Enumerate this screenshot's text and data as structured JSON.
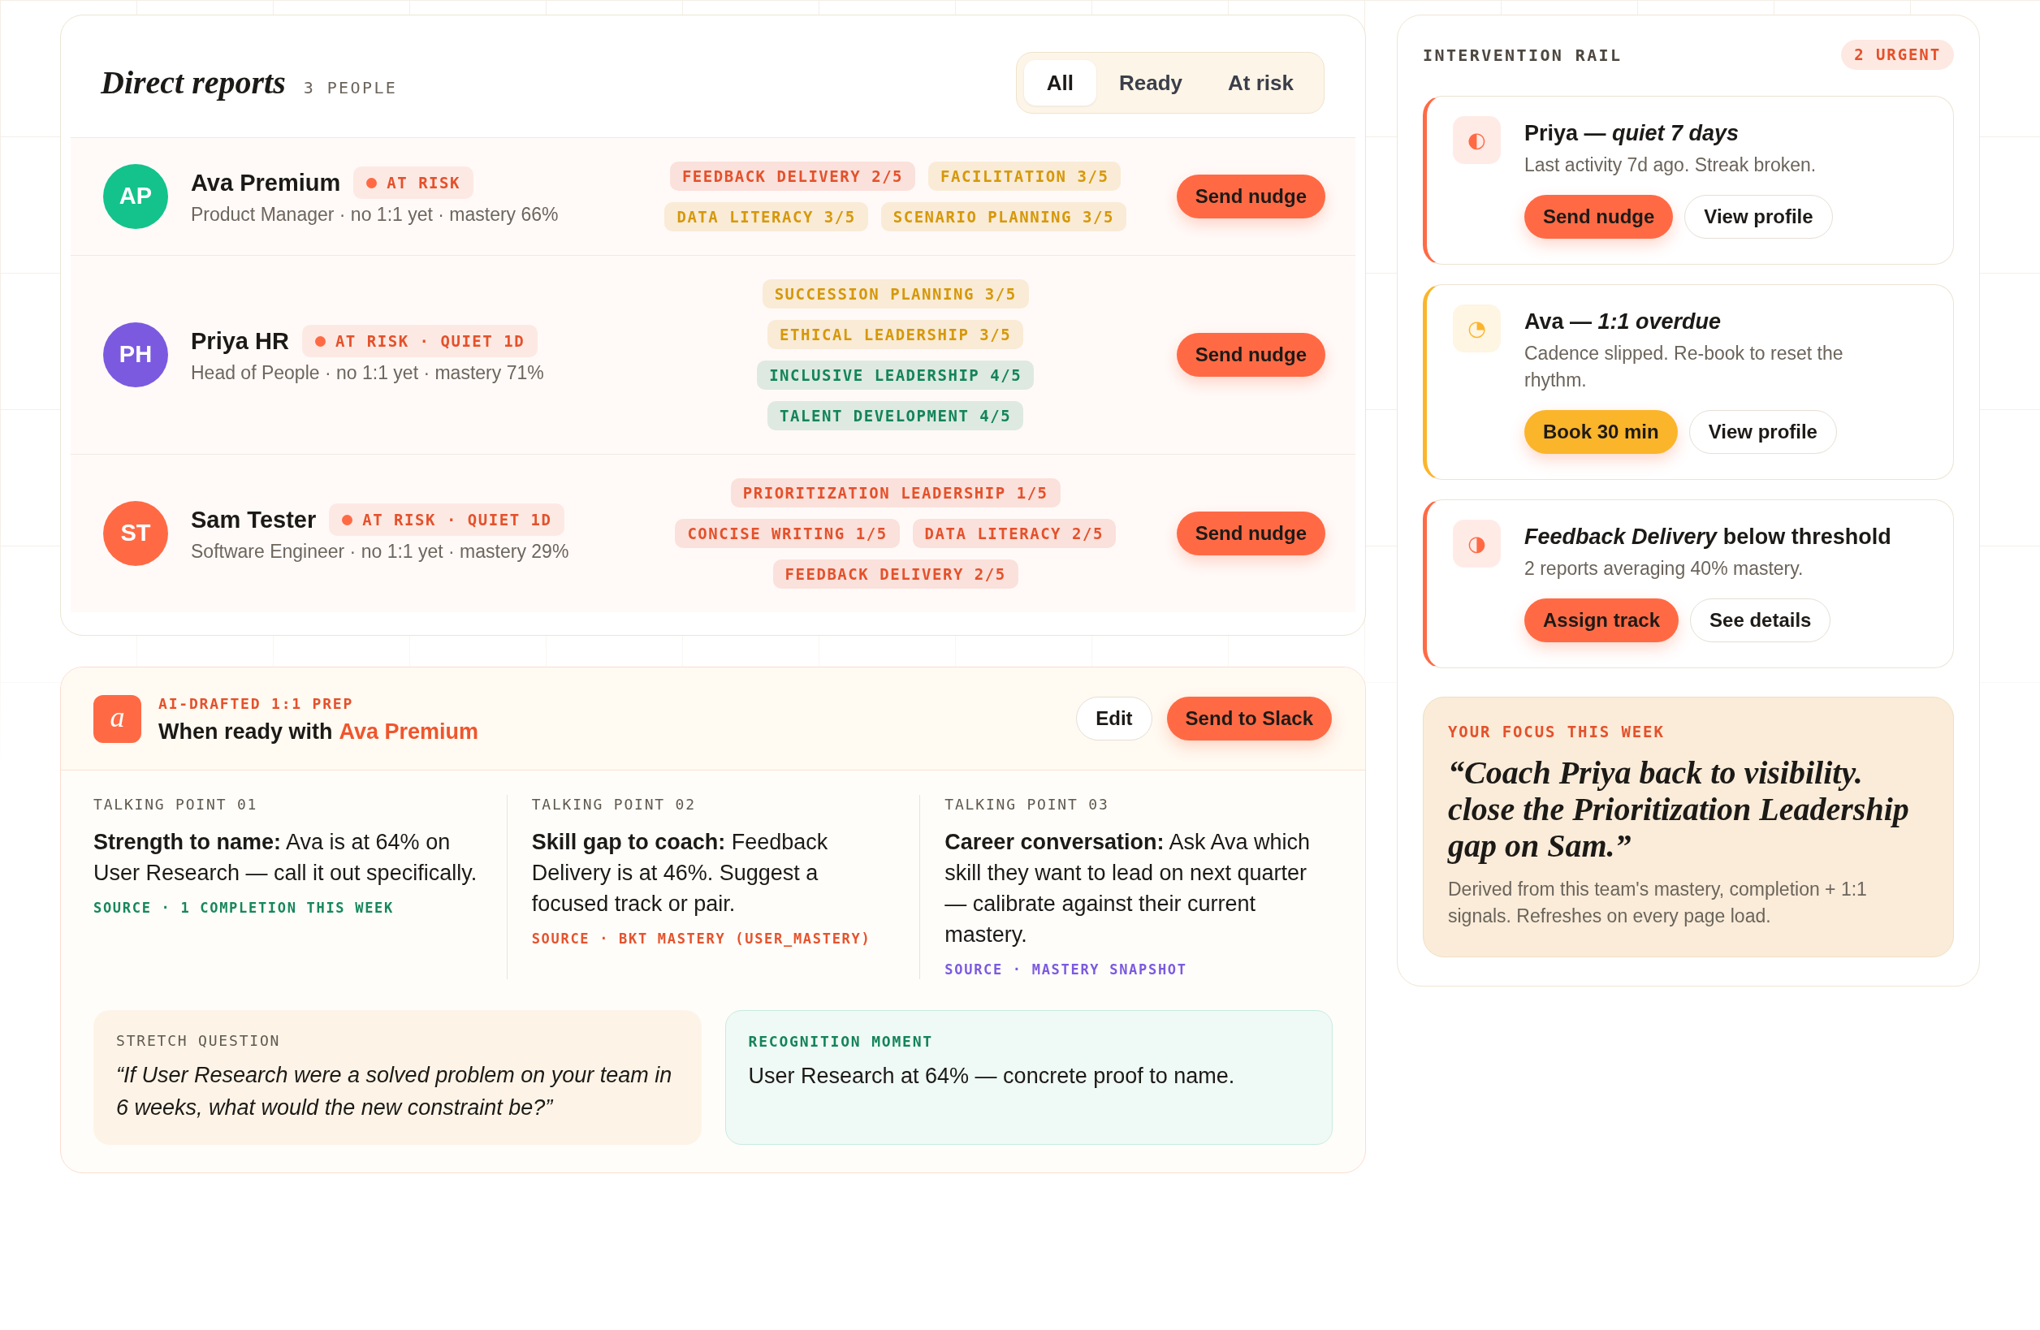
{
  "direct_reports": {
    "title": "Direct reports",
    "count": "3 PEOPLE",
    "filters": [
      {
        "label": "All",
        "selected": true
      },
      {
        "label": "Ready",
        "selected": false
      },
      {
        "label": "At risk",
        "selected": false
      }
    ],
    "reports": [
      {
        "initials": "AP",
        "color": "#14c28c",
        "name": "Ava Premium",
        "status": "AT RISK",
        "meta": "Product Manager · no 1:1 yet · mastery 66%",
        "skills": [
          {
            "label": "FEEDBACK DELIVERY 2/5",
            "color": "#e4512b"
          },
          {
            "label": "FACILITATION 3/5",
            "color": "#d6980a"
          },
          {
            "label": "DATA LITERACY 3/5",
            "color": "#d6980a"
          },
          {
            "label": "SCENARIO PLANNING 3/5",
            "color": "#d6980a"
          }
        ],
        "action": "Send nudge"
      },
      {
        "initials": "PH",
        "color": "#7b5ae0",
        "name": "Priya HR",
        "status": "AT RISK · QUIET 1D",
        "meta": "Head of People · no 1:1 yet · mastery 71%",
        "skills": [
          {
            "label": "SUCCESSION PLANNING 3/5",
            "color": "#d6980a"
          },
          {
            "label": "ETHICAL LEADERSHIP 3/5",
            "color": "#d6980a"
          },
          {
            "label": "INCLUSIVE LEADERSHIP 4/5",
            "color": "#13845a"
          },
          {
            "label": "TALENT DEVELOPMENT 4/5",
            "color": "#13845a"
          }
        ],
        "action": "Send nudge"
      },
      {
        "initials": "ST",
        "color": "#ff6a45",
        "name": "Sam Tester",
        "status": "AT RISK · QUIET 1D",
        "meta": "Software Engineer · no 1:1 yet · mastery 29%",
        "skills": [
          {
            "label": "PRIORITIZATION LEADERSHIP 1/5",
            "color": "#e4512b"
          },
          {
            "label": "CONCISE WRITING 1/5",
            "color": "#e4512b"
          },
          {
            "label": "DATA LITERACY 2/5",
            "color": "#e4512b"
          },
          {
            "label": "FEEDBACK DELIVERY 2/5",
            "color": "#e4512b"
          }
        ],
        "action": "Send nudge"
      }
    ]
  },
  "prep": {
    "logo": "a",
    "eyebrow": "AI-DRAFTED 1:1 PREP",
    "title": "When ready with",
    "person": "Ava Premium",
    "buttons": [
      {
        "label": "Edit",
        "kind": "secondary"
      },
      {
        "label": "Send to Slack",
        "kind": "primary"
      }
    ],
    "talking_points": [
      {
        "label": "TALKING POINT 01",
        "text": "**Strength to name:** Ava is at 64% on User Research — call it out specifically.",
        "source": "SOURCE · 1 COMPLETION THIS WEEK",
        "color": "#16875c"
      },
      {
        "label": "TALKING POINT 02",
        "text": "**Skill gap to coach:** Feedback Delivery is at 46%. Suggest a focused track or pair.",
        "source": "SOURCE · BKT MASTERY (USER_MASTERY)",
        "color": "#e5532d"
      },
      {
        "label": "TALKING POINT 03",
        "text": "**Career conversation:** Ask Ava which skill they want to lead on next quarter — calibrate against their current mastery.",
        "source": "SOURCE · MASTERY SNAPSHOT",
        "color": "#7b5ae0"
      }
    ],
    "stretch_question": {
      "label": "STRETCH QUESTION",
      "text": "“If User Research were a solved problem on your team in 6 weeks, what would the new constraint be?”"
    },
    "recognition": {
      "label": "RECOGNITION MOMENT",
      "text": "User Research at 64% — concrete proof to name."
    }
  },
  "rail": {
    "title": "INTERVENTION RAIL",
    "badge": "2 URGENT",
    "items": [
      {
        "color": "#ff6a45",
        "glyph": "◐",
        "title": "Priya — *quiet 7 days*",
        "text": "Last activity 7d ago. Streak broken.",
        "actions": [
          {
            "label": "Send nudge",
            "kind": "primary"
          },
          {
            "label": "View profile",
            "kind": "secondary"
          }
        ]
      },
      {
        "color": "#fbb52b",
        "glyph": "◔",
        "title": "Ava — *1:1 overdue*",
        "text": "Cadence slipped. Re-book to reset the rhythm.",
        "actions": [
          {
            "label": "Book 30 min",
            "kind": "primary"
          },
          {
            "label": "View profile",
            "kind": "secondary"
          }
        ]
      },
      {
        "color": "#ff6a45",
        "glyph": "◑",
        "title": "*Feedback Delivery* below threshold",
        "text": "2 reports averaging 40% mastery.",
        "actions": [
          {
            "label": "Assign track",
            "kind": "primary"
          },
          {
            "label": "See details",
            "kind": "secondary"
          }
        ]
      }
    ]
  },
  "focus": {
    "label": "YOUR FOCUS THIS WEEK",
    "quote": "“Coach Priya back to visibility. close the Prioritization Leadership gap on Sam.”",
    "note": "Derived from this team's mastery, completion + 1:1 signals. Refreshes on every page load."
  }
}
